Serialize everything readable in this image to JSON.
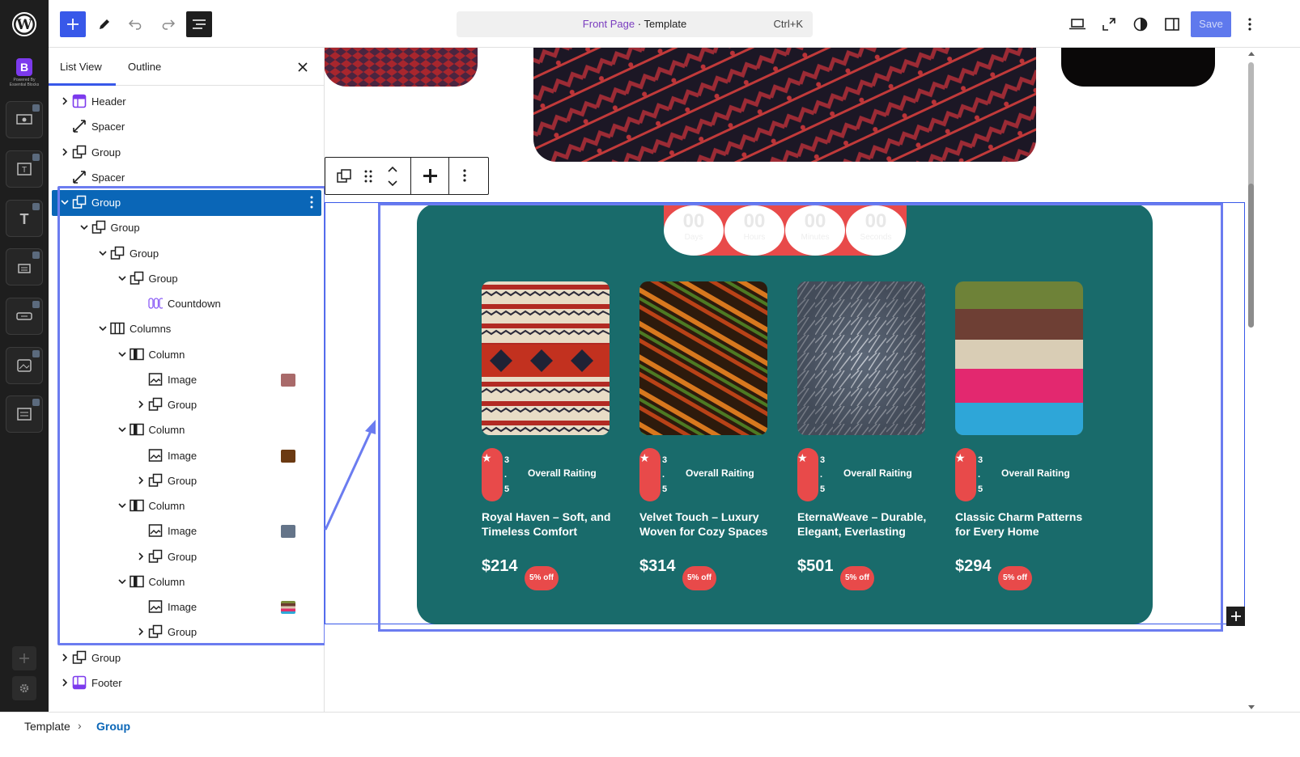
{
  "topbar": {
    "command": {
      "highlight": "Front Page",
      "separator": " · ",
      "rest": "Template",
      "shortcut": "Ctrl+K"
    },
    "save_label": "Save"
  },
  "rail": {
    "brand_caption": "Powered By Essential Blocks",
    "brand_letter": "B"
  },
  "panel": {
    "tabs": [
      "List View",
      "Outline"
    ],
    "rows": [
      {
        "label": "Header"
      },
      {
        "label": "Spacer"
      },
      {
        "label": "Group"
      },
      {
        "label": "Spacer"
      },
      {
        "label": "Group"
      },
      {
        "label": "Group"
      },
      {
        "label": "Group"
      },
      {
        "label": "Group"
      },
      {
        "label": "Countdown"
      },
      {
        "label": "Columns"
      },
      {
        "label": "Column"
      },
      {
        "label": "Image"
      },
      {
        "label": "Group"
      },
      {
        "label": "Column"
      },
      {
        "label": "Image"
      },
      {
        "label": "Group"
      },
      {
        "label": "Column"
      },
      {
        "label": "Image"
      },
      {
        "label": "Group"
      },
      {
        "label": "Column"
      },
      {
        "label": "Image"
      },
      {
        "label": "Group"
      },
      {
        "label": "Group"
      },
      {
        "label": "Footer"
      }
    ]
  },
  "countdown": [
    {
      "num": "00",
      "label": "Days"
    },
    {
      "num": "00",
      "label": "Hours"
    },
    {
      "num": "00",
      "label": "Minutes"
    },
    {
      "num": "00",
      "label": "Seconds"
    }
  ],
  "products": [
    {
      "rating_digits": [
        "3",
        ".",
        "5"
      ],
      "rating_label": "Overall Raiting",
      "title": "Royal Haven – Soft, and Timeless Comfort",
      "price": "$214",
      "badge": "5% off"
    },
    {
      "rating_digits": [
        "3",
        ".",
        "5"
      ],
      "rating_label": "Overall Raiting",
      "title": "Velvet Touch – Luxury Woven for Cozy Spaces",
      "price": "$314",
      "badge": "5% off"
    },
    {
      "rating_digits": [
        "3",
        ".",
        "5"
      ],
      "rating_label": "Overall Raiting",
      "title": "EternaWeave – Durable, Elegant, Everlasting",
      "price": "$501",
      "badge": "5% off"
    },
    {
      "rating_digits": [
        "3",
        ".",
        "5"
      ],
      "rating_label": "Overall Raiting",
      "title": "Classic Charm Patterns for Every Home",
      "price": "$294",
      "badge": "5% off"
    }
  ],
  "breadcrumb": {
    "root": "Template",
    "current": "Group"
  },
  "colors": {
    "accent": "#3858e9",
    "selected_row": "#0a66b7",
    "card": "#196b6b",
    "red": "#e84a4a"
  }
}
